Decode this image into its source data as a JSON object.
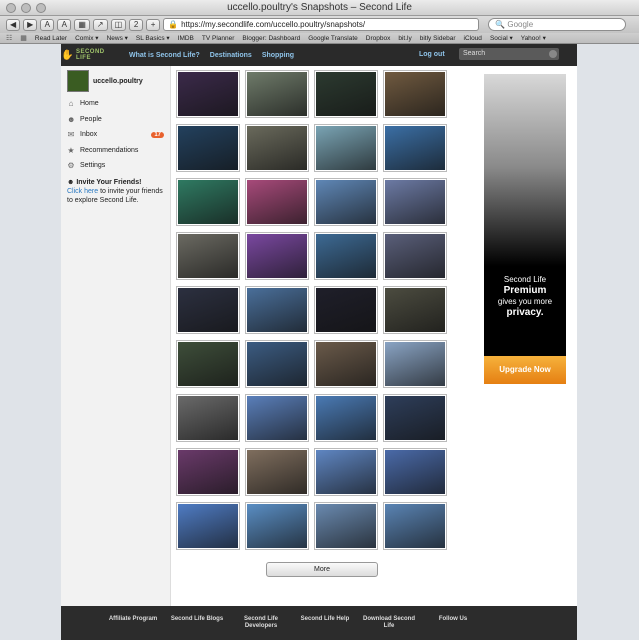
{
  "window": {
    "title": "uccello.poultry's Snapshots – Second Life"
  },
  "toolbar": {
    "url": "https://my.secondlife.com/uccello.poultry/snapshots/",
    "search_placeholder": "Google",
    "tab_count": "2"
  },
  "bookmarks": [
    "Read Later",
    "Comix ▾",
    "News ▾",
    "SL Basics ▾",
    "IMDB",
    "TV Planner",
    "Blogger: Dashboard",
    "Google Translate",
    "Dropbox",
    "bit.ly",
    "bitly Sidebar",
    "iCloud",
    "Social ▾",
    "Yahoo! ▾"
  ],
  "nav": {
    "logo": "SECOND LIFE",
    "links": [
      "What is Second Life?",
      "Destinations",
      "Shopping"
    ],
    "logout": "Log out",
    "search_placeholder": "Search"
  },
  "sidebar": {
    "username": "uccello.poultry",
    "items": [
      {
        "label": "Home",
        "icon": "home-icon"
      },
      {
        "label": "People",
        "icon": "people-icon"
      },
      {
        "label": "Inbox",
        "icon": "mail-icon",
        "badge": "17"
      },
      {
        "label": "Recommendations",
        "icon": "thumbs-icon"
      },
      {
        "label": "Settings",
        "icon": "gear-icon"
      }
    ],
    "invite_title": "Invite Your Friends!",
    "invite_link": "Click here",
    "invite_text": " to invite your friends to explore Second Life."
  },
  "thumbs": [
    "#3b2a4a",
    "#6f7b6a",
    "#2c3a30",
    "#705a40",
    "#23415e",
    "#6a6a5c",
    "#7aa4b4",
    "#3b6fa5",
    "#2f7a62",
    "#a74a7a",
    "#5f87b6",
    "#6c7aa4",
    "#6b6a62",
    "#7a48a0",
    "#3d6a94",
    "#5a5f7a",
    "#2c3040",
    "#4a6f9a",
    "#1f1f2a",
    "#4c4c40",
    "#3e4e3a",
    "#3c5c82",
    "#6a5a4a",
    "#8aa4c4",
    "#6a6a6a",
    "#5a7fba",
    "#4a7ab4",
    "#2e3e5a",
    "#6a3a6a",
    "#7f6e5e",
    "#5f86c2",
    "#4a6aa8",
    "#4f7cc4",
    "#5a8ec4",
    "#6a8ab0",
    "#5a84b4"
  ],
  "more_label": "More",
  "ad": {
    "line1": "Second Life",
    "line2": "Premium",
    "line3": "gives you more",
    "line4": "privacy.",
    "button": "Upgrade Now"
  },
  "footer": [
    "Affiliate Program",
    "Second Life Blogs",
    "Second Life Developers",
    "Second Life Help",
    "Download Second Life",
    "Follow Us"
  ]
}
